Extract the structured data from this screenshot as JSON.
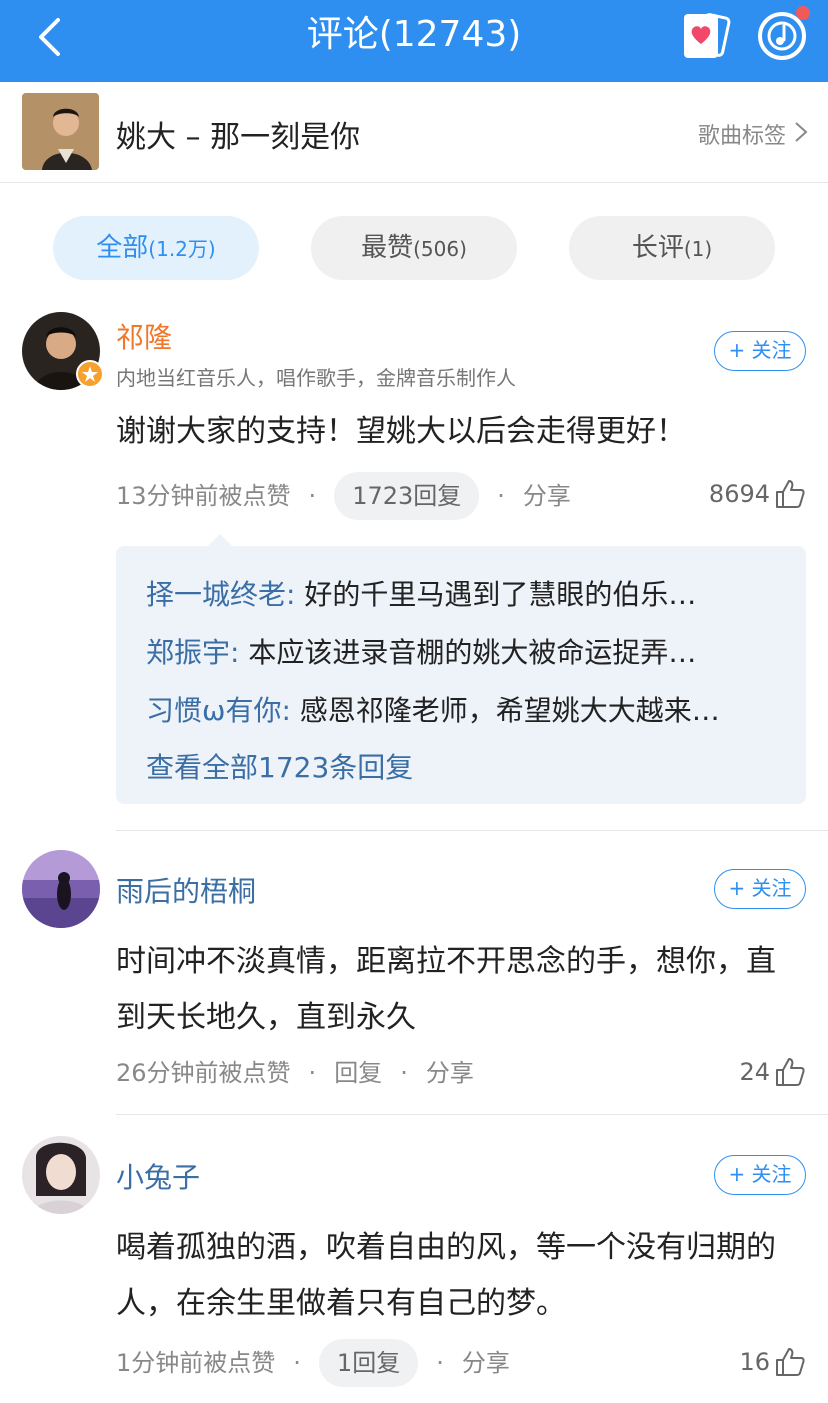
{
  "header": {
    "title": "评论(12743)",
    "back_icon": "chevron-left-icon",
    "cards_icon": "heart-cards-icon",
    "music_icon": "music-note-icon",
    "bg_color": "#2f8ff0"
  },
  "song": {
    "title": "姚大 – 那一刻是你",
    "tag_label": "歌曲标签"
  },
  "tabs": [
    {
      "label": "全部",
      "count": "(1.2万)",
      "active": true
    },
    {
      "label": "最赞",
      "count": "(506)",
      "active": false
    },
    {
      "label": "长评",
      "count": "(1)",
      "active": false
    }
  ],
  "follow_label": "+ 关注",
  "comments": [
    {
      "name": "祁隆",
      "bio": "内地当红音乐人，唱作歌手，金牌音乐制作人",
      "text": "谢谢大家的支持！望姚大以后会走得更好！",
      "time": "13分钟前被点赞",
      "reply_label": "1723回复",
      "share_label": "分享",
      "likes": "8694",
      "replies": [
        {
          "user": "择一城终老:",
          "text": " 好的千里马遇到了慧眼的伯乐…"
        },
        {
          "user": "郑振宇:",
          "text": " 本应该进录音棚的姚大被命运捉弄…"
        },
        {
          "user": "习惯ω有你:",
          "text": " 感恩祁隆老师，希望姚大大越来…"
        }
      ],
      "view_all": "查看全部1723条回复"
    },
    {
      "name": "雨后的梧桐",
      "text": "时间冲不淡真情，距离拉不开思念的手，想你，直到天长地久，直到永久",
      "time": "26分钟前被点赞",
      "reply_label": "回复",
      "share_label": "分享",
      "likes": "24"
    },
    {
      "name": "小兔子",
      "text": "喝着孤独的酒，吹着自由的风，等一个没有归期的人，在余生里做着只有自己的梦。",
      "time": "1分钟前被点赞",
      "reply_label": "1回复",
      "share_label": "分享",
      "likes": "16"
    }
  ]
}
